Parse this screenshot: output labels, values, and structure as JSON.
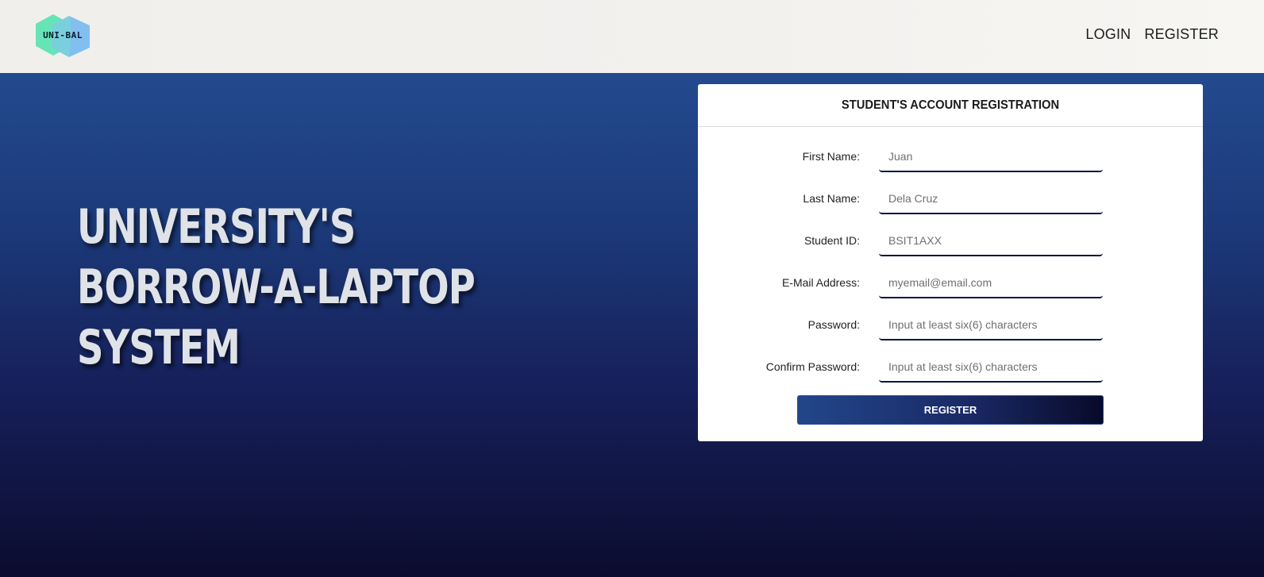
{
  "header": {
    "logo_text": "UNI-BAL",
    "nav": {
      "login": "LOGIN",
      "register": "REGISTER"
    }
  },
  "hero": {
    "line1": "UNIVERSITY'S",
    "line2": "BORROW-A-LAPTOP",
    "line3": "SYSTEM"
  },
  "form": {
    "title": "STUDENT'S ACCOUNT REGISTRATION",
    "fields": [
      {
        "label": "First Name:",
        "placeholder": "Juan",
        "type": "text"
      },
      {
        "label": "Last Name:",
        "placeholder": "Dela Cruz",
        "type": "text"
      },
      {
        "label": "Student ID:",
        "placeholder": "BSIT1AXX",
        "type": "text"
      },
      {
        "label": "E-Mail Address:",
        "placeholder": "myemail@email.com",
        "type": "email"
      },
      {
        "label": "Password:",
        "placeholder": "Input at least six(6) characters",
        "type": "password"
      },
      {
        "label": "Confirm Password:",
        "placeholder": "Input at least six(6) characters",
        "type": "password"
      }
    ],
    "submit_label": "REGISTER"
  },
  "colors": {
    "header_bg": "#f2f0ed",
    "hero_top": "#234a8e",
    "hero_bottom": "#0b0c2e",
    "input_underline": "#0e1640",
    "logo_teal": "#5fe3b4",
    "logo_blue": "#6fb6f0"
  }
}
